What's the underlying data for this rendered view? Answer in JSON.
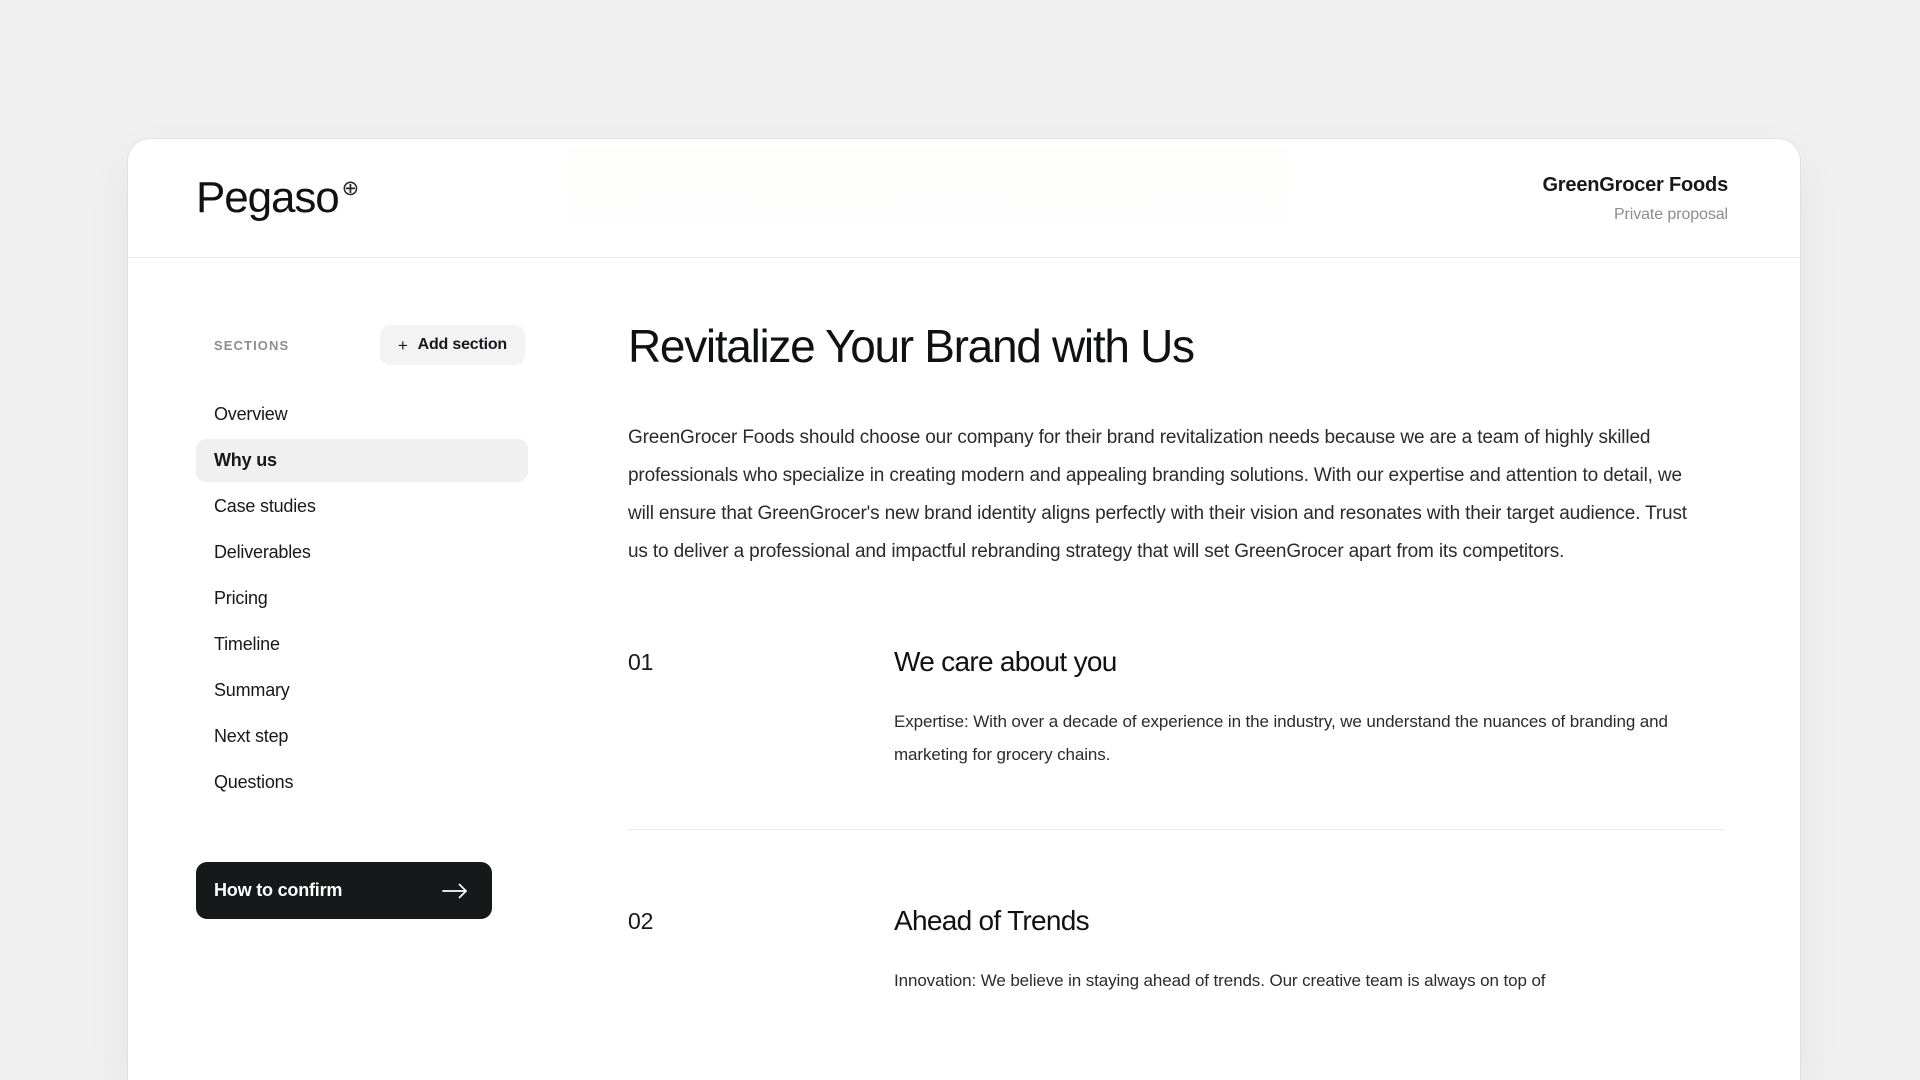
{
  "header": {
    "brand_name": "Pegaso",
    "brand_mark": "⊕",
    "client_name": "GreenGrocer Foods",
    "client_subtitle": "Private proposal"
  },
  "sidebar": {
    "sections_label": "SECTIONS",
    "add_section": {
      "label": "Add section",
      "plus": "+"
    },
    "items": [
      {
        "label": "Overview",
        "active": false
      },
      {
        "label": "Why us",
        "active": true
      },
      {
        "label": "Case studies",
        "active": false
      },
      {
        "label": "Deliverables",
        "active": false
      },
      {
        "label": "Pricing",
        "active": false
      },
      {
        "label": "Timeline",
        "active": false
      },
      {
        "label": "Summary",
        "active": false
      },
      {
        "label": "Next step",
        "active": false
      },
      {
        "label": "Questions",
        "active": false
      }
    ],
    "confirm_button": {
      "label": "How to confirm",
      "arrow": "→"
    }
  },
  "main": {
    "title": "Revitalize Your Brand with Us",
    "intro": "GreenGrocer Foods should choose our company for their brand revitalization needs because we are a team of highly skilled professionals who specialize in creating modern and appealing branding solutions. With our expertise and attention to detail, we will ensure that GreenGrocer's new brand identity aligns perfectly with their vision and resonates with their target audience. Trust us to deliver a professional and impactful rebranding strategy that will set GreenGrocer apart from its competitors.",
    "features": [
      {
        "number": "01",
        "title": "We care about you",
        "text": "Expertise: With over a decade of experience in the industry, we understand the nuances of branding and marketing for grocery chains."
      },
      {
        "number": "02",
        "title": "Ahead of Trends",
        "text": "Innovation: We believe in staying ahead of trends. Our creative team is always on top of"
      }
    ]
  },
  "colors": {
    "page_background": "#f0f0f1",
    "card_background": "#ffffff",
    "text_primary": "#17181a",
    "text_muted": "#8b8c90",
    "accent_dark": "#17181a",
    "active_pill": "#f0f0f1",
    "divider": "#e9e9ea"
  }
}
